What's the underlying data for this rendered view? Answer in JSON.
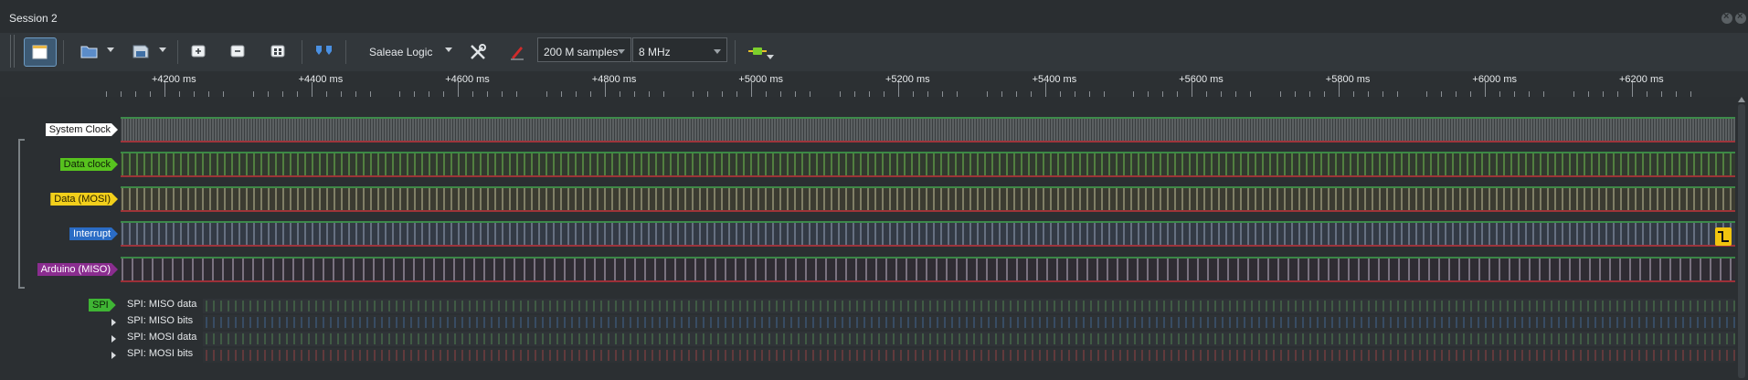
{
  "window": {
    "title": "Session 2"
  },
  "toolbar": {
    "device_name": "Saleae Logic",
    "samples_value": "200 M samples",
    "rate_value": "8 MHz",
    "buttons": [
      "start-capture",
      "open",
      "save",
      "zoom-in",
      "zoom-out",
      "fit",
      "cursors",
      "device-settings",
      "annotate",
      "connect"
    ]
  },
  "ruler": {
    "labels": [
      "+4200 ms",
      "+4400 ms",
      "+4600 ms",
      "+4800 ms",
      "+5000 ms",
      "+5200 ms",
      "+5400 ms",
      "+5600 ms",
      "+5800 ms",
      "+6000 ms",
      "+6200 ms"
    ]
  },
  "channels": [
    {
      "name": "System Clock",
      "label_color": "#ffffff",
      "text_color": "#111111",
      "lane_bg": "#3a3e40",
      "signal_color": "#6a6e71",
      "style": "dense"
    },
    {
      "name": "Data clock",
      "label_color": "#57c21e",
      "text_color": "#102008",
      "lane_bg": "#313a2f",
      "signal_color": "#72c450",
      "style": "regular"
    },
    {
      "name": "Data (MOSI)",
      "label_color": "#f2cf1b",
      "text_color": "#2a2200",
      "lane_bg": "#3b3b31",
      "signal_color": "#c6c39a",
      "style": "regular"
    },
    {
      "name": "Interrupt",
      "label_color": "#2b6cc5",
      "text_color": "#ffffff",
      "lane_bg": "#333a45",
      "signal_color": "#9aa6bd",
      "style": "regular"
    },
    {
      "name": "Arduino (MISO)",
      "label_color": "#8a2d8f",
      "text_color": "#ffffff",
      "lane_bg": "#2f2c33",
      "signal_color": "#c5b8cc",
      "style": "sparse"
    }
  ],
  "analyzer": {
    "badge": "SPI",
    "badge_color": "#3fb534",
    "rows": [
      "SPI: MISO data",
      "SPI: MISO bits",
      "SPI: MOSI data",
      "SPI: MOSI bits"
    ]
  },
  "icons": {
    "trigger": "falling-edge-trigger-icon"
  }
}
